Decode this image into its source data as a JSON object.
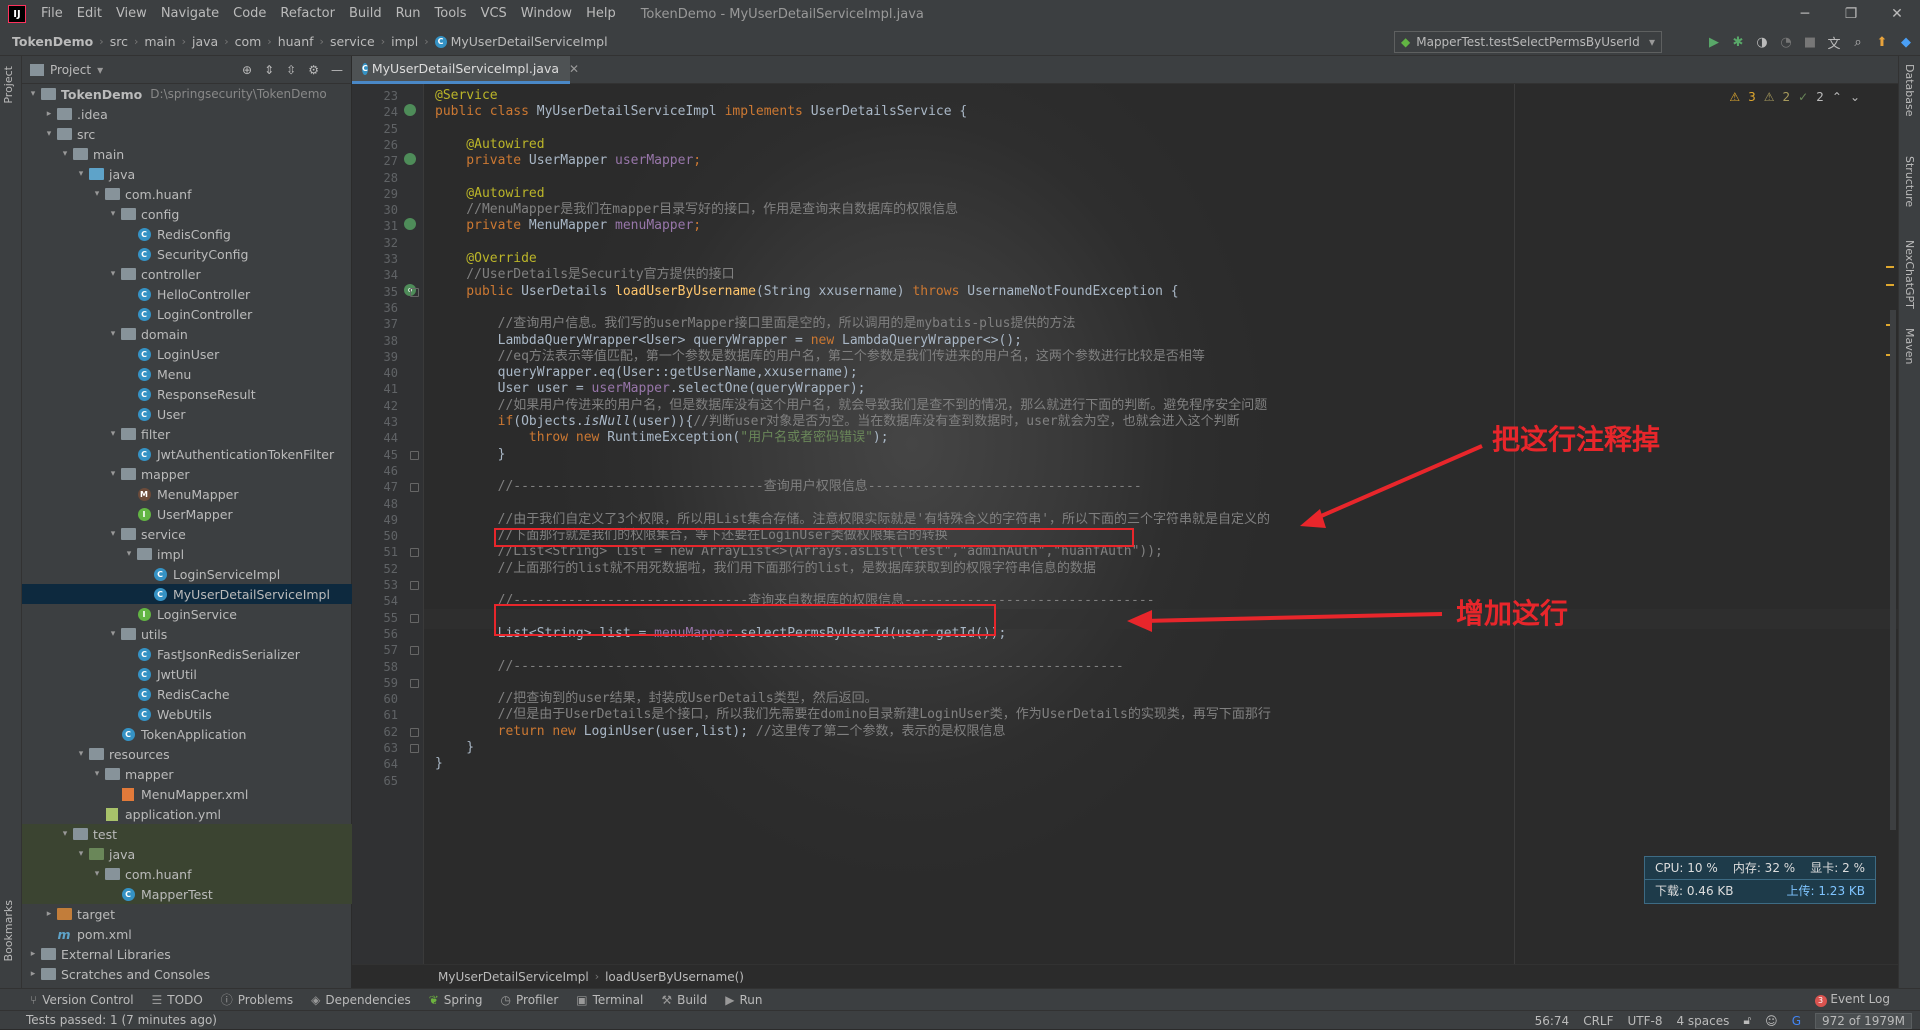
{
  "menubar": {
    "logo": "IJ",
    "items": [
      "File",
      "Edit",
      "View",
      "Navigate",
      "Code",
      "Refactor",
      "Build",
      "Run",
      "Tools",
      "VCS",
      "Window",
      "Help"
    ],
    "title": "TokenDemo - MyUserDetailServiceImpl.java"
  },
  "navbar": {
    "crumbs": [
      "TokenDemo",
      "src",
      "main",
      "java",
      "com",
      "huanf",
      "service",
      "impl",
      "MyUserDetailServiceImpl"
    ],
    "run_config": "MapperTest.testSelectPermsByUserId"
  },
  "left_tabs": {
    "project": "Project",
    "bookmarks": "Bookmarks"
  },
  "right_tabs": [
    "Database",
    "Structure",
    "NexChatGPT",
    "Maven"
  ],
  "project": {
    "title": "Project",
    "tree": [
      {
        "label": "TokenDemo",
        "path": "D:\\springsecurity\\TokenDemo",
        "depth": 0,
        "type": "module",
        "open": true
      },
      {
        "label": ".idea",
        "depth": 1,
        "type": "folder",
        "open": false
      },
      {
        "label": "src",
        "depth": 1,
        "type": "folder",
        "open": true
      },
      {
        "label": "main",
        "depth": 2,
        "type": "folder",
        "open": true
      },
      {
        "label": "java",
        "depth": 3,
        "type": "folder-blue",
        "open": true
      },
      {
        "label": "com.huanf",
        "depth": 4,
        "type": "folder",
        "open": true
      },
      {
        "label": "config",
        "depth": 5,
        "type": "folder",
        "open": true
      },
      {
        "label": "RedisConfig",
        "depth": 6,
        "type": "class"
      },
      {
        "label": "SecurityConfig",
        "depth": 6,
        "type": "class"
      },
      {
        "label": "controller",
        "depth": 5,
        "type": "folder",
        "open": true
      },
      {
        "label": "HelloController",
        "depth": 6,
        "type": "class"
      },
      {
        "label": "LoginController",
        "depth": 6,
        "type": "class"
      },
      {
        "label": "domain",
        "depth": 5,
        "type": "folder",
        "open": true
      },
      {
        "label": "LoginUser",
        "depth": 6,
        "type": "class"
      },
      {
        "label": "Menu",
        "depth": 6,
        "type": "class"
      },
      {
        "label": "ResponseResult",
        "depth": 6,
        "type": "class"
      },
      {
        "label": "User",
        "depth": 6,
        "type": "class"
      },
      {
        "label": "filter",
        "depth": 5,
        "type": "folder",
        "open": true
      },
      {
        "label": "JwtAuthenticationTokenFilter",
        "depth": 6,
        "type": "class"
      },
      {
        "label": "mapper",
        "depth": 5,
        "type": "folder",
        "open": true
      },
      {
        "label": "MenuMapper",
        "depth": 6,
        "type": "mapper"
      },
      {
        "label": "UserMapper",
        "depth": 6,
        "type": "interface"
      },
      {
        "label": "service",
        "depth": 5,
        "type": "folder",
        "open": true
      },
      {
        "label": "impl",
        "depth": 6,
        "type": "folder",
        "open": true
      },
      {
        "label": "LoginServiceImpl",
        "depth": 7,
        "type": "class"
      },
      {
        "label": "MyUserDetailServiceImpl",
        "depth": 7,
        "type": "class",
        "selected": true
      },
      {
        "label": "LoginService",
        "depth": 6,
        "type": "interface"
      },
      {
        "label": "utils",
        "depth": 5,
        "type": "folder",
        "open": true
      },
      {
        "label": "FastJsonRedisSerializer",
        "depth": 6,
        "type": "class"
      },
      {
        "label": "JwtUtil",
        "depth": 6,
        "type": "class"
      },
      {
        "label": "RedisCache",
        "depth": 6,
        "type": "class"
      },
      {
        "label": "WebUtils",
        "depth": 6,
        "type": "class"
      },
      {
        "label": "TokenApplication",
        "depth": 5,
        "type": "class"
      },
      {
        "label": "resources",
        "depth": 3,
        "type": "folder",
        "open": true
      },
      {
        "label": "mapper",
        "depth": 4,
        "type": "folder",
        "open": true
      },
      {
        "label": "MenuMapper.xml",
        "depth": 5,
        "type": "xml"
      },
      {
        "label": "application.yml",
        "depth": 4,
        "type": "yml"
      },
      {
        "label": "test",
        "depth": 2,
        "type": "folder",
        "open": true,
        "test": true
      },
      {
        "label": "java",
        "depth": 3,
        "type": "folder-green",
        "open": true,
        "test": true
      },
      {
        "label": "com.huanf",
        "depth": 4,
        "type": "folder",
        "open": true,
        "test": true
      },
      {
        "label": "MapperTest",
        "depth": 5,
        "type": "class",
        "test": true
      },
      {
        "label": "target",
        "depth": 1,
        "type": "folder-orange",
        "open": false
      },
      {
        "label": "pom.xml",
        "depth": 1,
        "type": "pom"
      },
      {
        "label": "External Libraries",
        "depth": 0,
        "type": "lib",
        "open": false
      },
      {
        "label": "Scratches and Consoles",
        "depth": 0,
        "type": "scratch",
        "open": false
      }
    ]
  },
  "editor": {
    "tab": "MyUserDetailServiceImpl.java",
    "indicators": {
      "warnings": "3",
      "weak": "2",
      "typos": "2"
    },
    "first_line": 23,
    "lines": [
      [
        [
          "an",
          "@Service"
        ]
      ],
      [
        [
          "kw",
          "public class "
        ],
        [
          "",
          "MyUserDetailServiceImpl "
        ],
        [
          "kw",
          "implements "
        ],
        [
          "",
          "UserDetailsService {"
        ]
      ],
      [],
      [
        [
          "an",
          "    @Autowired"
        ]
      ],
      [
        [
          "kw",
          "    private "
        ],
        [
          "",
          "UserMapper "
        ],
        [
          "fd",
          "userMapper"
        ],
        [
          "kw",
          ";"
        ]
      ],
      [],
      [
        [
          "an",
          "    @Autowired"
        ]
      ],
      [
        [
          "cm",
          "    //MenuMapper是我们在mapper目录写好的接口，作用是查询来自数据库的权限信息"
        ]
      ],
      [
        [
          "kw",
          "    private "
        ],
        [
          "",
          "MenuMapper "
        ],
        [
          "fd",
          "menuMapper"
        ],
        [
          "kw",
          ";"
        ]
      ],
      [],
      [
        [
          "an",
          "    @Override"
        ]
      ],
      [
        [
          "cm",
          "    //UserDetails是Security官方提供的接口"
        ]
      ],
      [
        [
          "kw",
          "    public "
        ],
        [
          "",
          "UserDetails "
        ],
        [
          "fn",
          "loadUserByUsername"
        ],
        [
          "",
          "(String xxusername) "
        ],
        [
          "kw",
          "throws "
        ],
        [
          "",
          "UsernameNotFoundException {"
        ]
      ],
      [],
      [
        [
          "cm",
          "        //查询用户信息。我们写的userMapper接口里面是空的，所以调用的是mybatis-plus提供的方法"
        ]
      ],
      [
        [
          "",
          "        LambdaQueryWrapper<User> queryWrapper = "
        ],
        [
          "kw",
          "new "
        ],
        [
          "",
          "LambdaQueryWrapper<>();"
        ]
      ],
      [
        [
          "cm",
          "        //eq方法表示等值匹配，第一个参数是数据库的用户名，第二个参数是我们传进来的用户名，这两个参数进行比较是否相等"
        ]
      ],
      [
        [
          "",
          "        queryWrapper.eq(User::getUserName,xxusername);"
        ]
      ],
      [
        [
          "",
          "        User user = "
        ],
        [
          "fd",
          "userMapper"
        ],
        [
          "",
          ".selectOne(queryWrapper);"
        ]
      ],
      [
        [
          "cm",
          "        //如果用户传进来的用户名，但是数据库没有这个用户名，就会导致我们是查不到的情况，那么就进行下面的判断。避免程序安全问题"
        ]
      ],
      [
        [
          "kw",
          "        if"
        ],
        [
          "",
          "(Objects."
        ],
        [
          "it",
          "isNull"
        ],
        [
          "",
          "(user)){"
        ],
        [
          "cm",
          "//判断user对象是否为空。当在数据库没有查到数据时，user就会为空，也就会进入这个判断"
        ]
      ],
      [
        [
          "kw",
          "            throw new "
        ],
        [
          "",
          "RuntimeException("
        ],
        [
          "st",
          "\"用户名或者密码错误\""
        ],
        [
          "",
          ");"
        ]
      ],
      [
        [
          "",
          "        }"
        ]
      ],
      [],
      [
        [
          "cm",
          "        //--------------------------------查询用户权限信息-----------------------------------"
        ]
      ],
      [],
      [
        [
          "cm",
          "        //由于我们自定义了3个权限，所以用List集合存储。注意权限实际就是'有特殊含义的字符串'，所以下面的三个字符串就是自定义的"
        ]
      ],
      [
        [
          "cm",
          "        //下面那行就是我们的权限集合，等下还要在LoginUser类做权限集合的转换"
        ]
      ],
      [
        [
          "cm",
          "        //List<String> list = new ArrayList<>(Arrays.asList(\"test\",\"adminAuth\",\"huanfAuth\"));"
        ]
      ],
      [
        [
          "cm",
          "        //上面那行的list就不用死数据啦，我们用下面那行的list，是数据库获取到的权限字符串信息的数据"
        ]
      ],
      [],
      [
        [
          "cm",
          "        //------------------------------查询来自数据库的权限信息--------------------------------"
        ]
      ],
      [],
      [
        [
          "",
          "        List<String> list = "
        ],
        [
          "fd",
          "menuMapper"
        ],
        [
          "",
          ".selectPermsByUserId(user.getId());"
        ]
      ],
      [],
      [
        [
          "cm",
          "        //------------------------------------------------------------------------------"
        ]
      ],
      [],
      [
        [
          "cm",
          "        //把查询到的user结果，封装成UserDetails类型，然后返回。"
        ]
      ],
      [
        [
          "cm",
          "        //但是由于UserDetails是个接口，所以我们先需要在domino目录新建LoginUser类，作为UserDetails的实现类，再写下面那行"
        ]
      ],
      [
        [
          "kw",
          "        return new "
        ],
        [
          "",
          "LoginUser(user,list); "
        ],
        [
          "cm",
          "//这里传了第二个参数，表示的是权限信息"
        ]
      ],
      [
        [
          "",
          "    }"
        ]
      ],
      [
        [
          "",
          "}"
        ]
      ],
      []
    ],
    "annotations": {
      "comment_out": "把这行注释掉",
      "add_line": "增加这行"
    },
    "breadcrumb": [
      "MyUserDetailServiceImpl",
      "loadUserByUsername()"
    ]
  },
  "monitor": {
    "cpu": "CPU: 10 %",
    "mem": "内存: 32 %",
    "gpu": "显卡: 2 %",
    "down": "下载: 0.46 KB",
    "up": "上传: 1.23 KB"
  },
  "tool_tabs": [
    "Version Control",
    "TODO",
    "Problems",
    "Dependencies",
    "Spring",
    "Profiler",
    "Terminal",
    "Build",
    "Run"
  ],
  "event_log": {
    "count": "3",
    "label": "Event Log"
  },
  "status": {
    "message": "Tests passed: 1 (7 minutes ago)",
    "position": "56:74",
    "line_sep": "CRLF",
    "encoding": "UTF-8",
    "indent": "4 spaces",
    "memory": "972 of 1979M"
  }
}
